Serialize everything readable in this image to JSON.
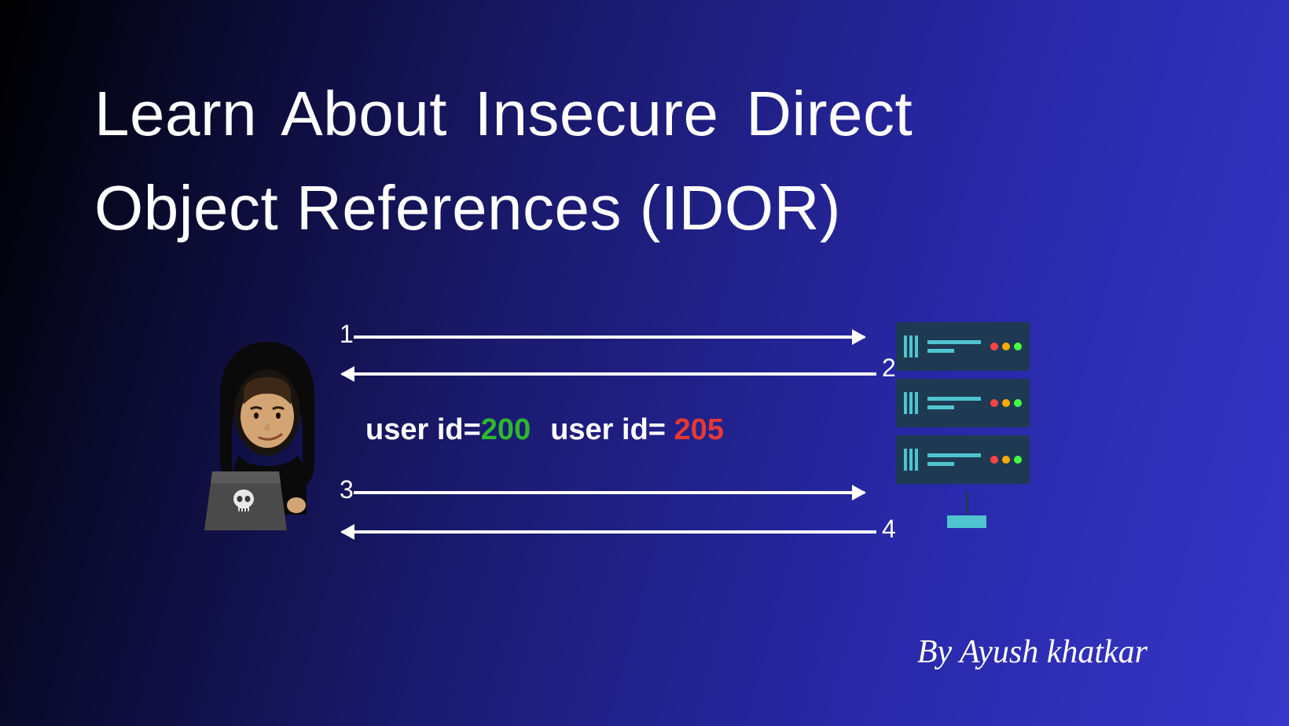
{
  "title": {
    "line1": "Learn About Insecure Direct",
    "line2": "Object References (IDOR)"
  },
  "diagram": {
    "arrows": {
      "a1": "1",
      "a2": "2",
      "a3": "3",
      "a4": "4"
    },
    "userid": {
      "left_label": "user id=",
      "left_value": "200",
      "right_label": "user id= ",
      "right_value": "205"
    },
    "server_dots": [
      "red",
      "orange",
      "green"
    ]
  },
  "author": "By Ayush khatkar",
  "colors": {
    "green": "#2db82d",
    "red": "#e53935",
    "server_body": "#1e3a52",
    "server_accent": "#4fc4cf"
  }
}
